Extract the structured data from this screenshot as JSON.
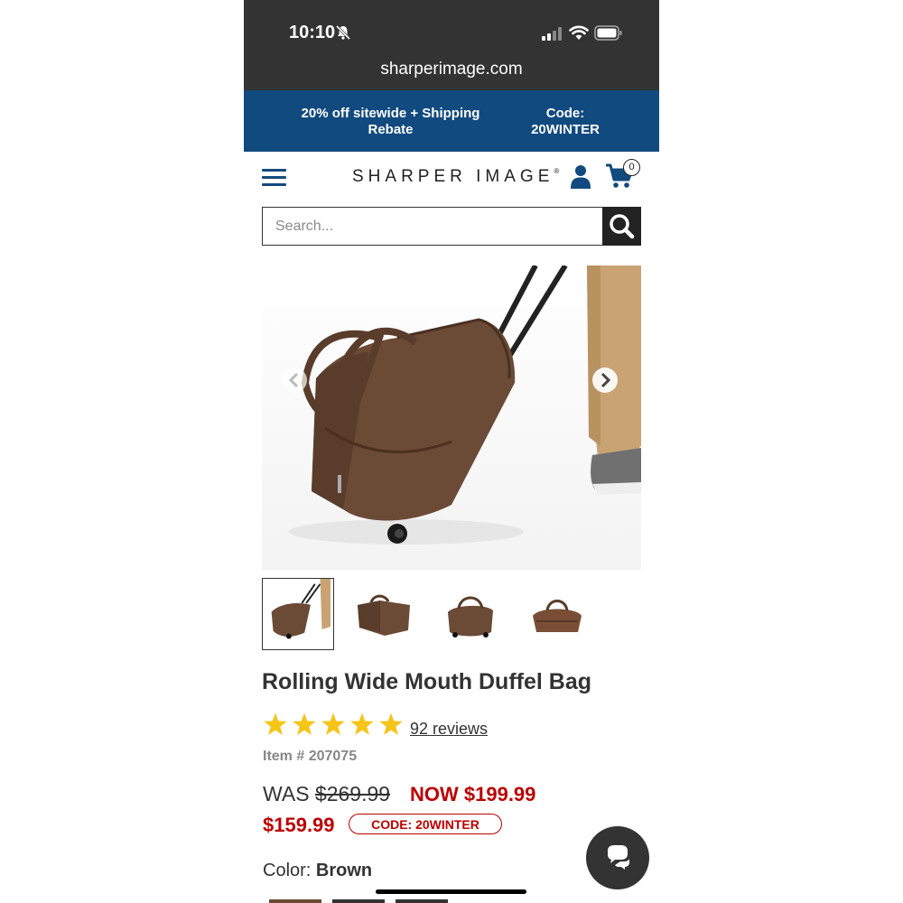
{
  "status": {
    "time": "10:10"
  },
  "browser": {
    "url": "sharperimage.com"
  },
  "promo": {
    "left_text": "20% off sitewide + Shipping Rebate",
    "right_text": "Code: 20WINTER"
  },
  "header": {
    "logo": "SHARPER IMAGE",
    "logo_mark": "®",
    "cart_count": "0"
  },
  "search": {
    "placeholder": "Search..."
  },
  "product": {
    "title": "Rolling Wide Mouth Duffel Bag",
    "rating": 5,
    "reviews": "92 reviews",
    "item_label": "Item #",
    "item_number": "207075",
    "was_label": "WAS",
    "was_price": "$269.99",
    "now_price": "NOW $199.99",
    "sale_price": "$159.99",
    "code_badge": "CODE: 20WINTER",
    "color_label": "Color:",
    "color_value": "Brown"
  },
  "colors": {
    "brand_blue": "#114a7e",
    "sale_red": "#bb0000",
    "star_yellow": "#f5c518"
  },
  "icons": [
    "bell-off-icon",
    "signal-icon",
    "wifi-icon",
    "battery-icon",
    "hamburger-icon",
    "user-icon",
    "cart-icon",
    "search-icon",
    "chevron-left-icon",
    "chevron-right-icon",
    "chat-icon"
  ]
}
